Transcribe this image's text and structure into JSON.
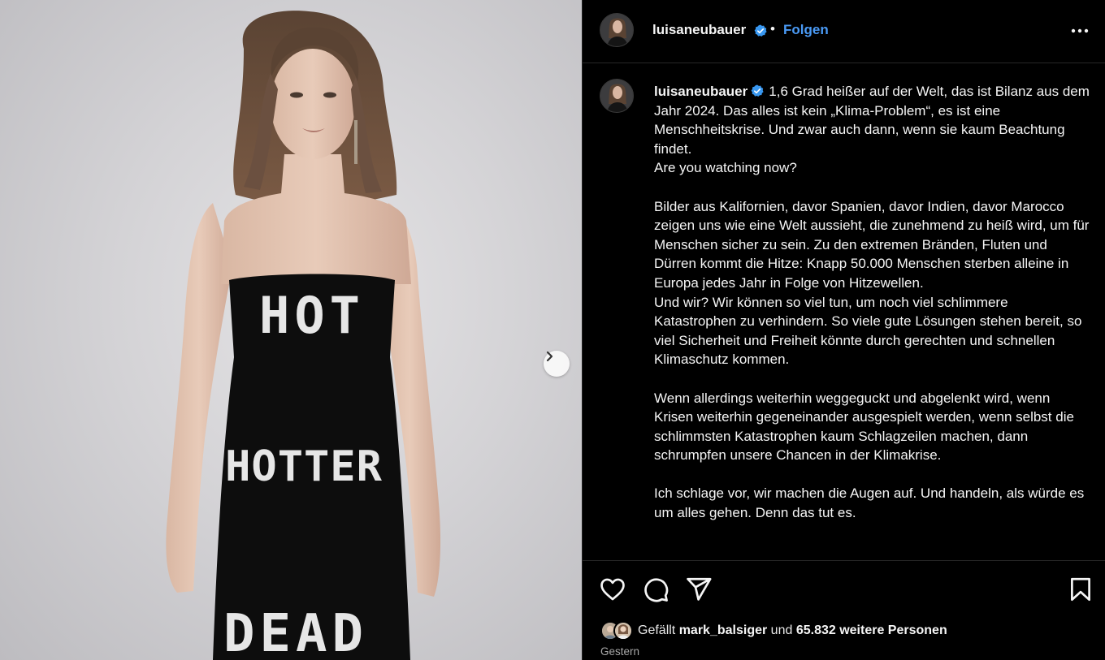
{
  "post": {
    "media": {
      "dress_text": [
        "HOT",
        "HOTTER",
        "DEAD"
      ],
      "next_icon": "chevron-right-icon"
    },
    "header": {
      "username": "luisaneubauer",
      "separator": "•",
      "follow_label": "Folgen",
      "more_icon": "more-horizontal-icon"
    },
    "caption": {
      "username": "luisaneubauer",
      "text": "1,6 Grad heißer auf der Welt, das ist Bilanz aus dem Jahr 2024. Das alles ist kein „Klima-Problem“, es ist eine Menschheitskrise. Und zwar auch dann, wenn sie kaum Beachtung findet.\nAre you watching now?\n\nBilder aus Kalifornien, davor Spanien, davor Indien, davor Marocco zeigen uns wie eine Welt aussieht, die zunehmend zu heiß wird, um für Menschen sicher zu sein. Zu den extremen Bränden, Fluten und Dürren kommt die Hitze: Knapp 50.000 Menschen sterben alleine in Europa jedes Jahr in Folge von Hitzewellen.\nUnd wir? Wir können so viel tun, um noch viel schlimmere Katastrophen zu verhindern. So viele gute Lösungen stehen bereit, so viel Sicherheit und Freiheit könnte durch gerechten und schnellen Klimaschutz kommen.\n\nWenn allerdings weiterhin weggeguckt und abgelenkt wird, wenn Krisen weiterhin gegeneinander ausgespielt werden, wenn selbst die schlimmsten Katastrophen kaum Schlagzeilen machen, dann schrumpfen unsere Chancen in der Klimakrise.\n\nIch schlage vor, wir machen die Augen auf. Und handeln, als würde es um alles gehen. Denn das tut es."
    },
    "actions": {
      "icons": [
        "heart-icon",
        "comment-icon",
        "share-icon",
        "bookmark-icon"
      ]
    },
    "likes": {
      "prefix": "Gefällt",
      "user": "mark_balsiger",
      "middle": "und",
      "count": "65.832 weitere Personen"
    },
    "timestamp": "Gestern",
    "colors": {
      "follow": "#4a9af5",
      "verified": "#3897f0",
      "background": "#000000",
      "text": "#f5f5f5",
      "muted": "#a8a8a8"
    }
  }
}
